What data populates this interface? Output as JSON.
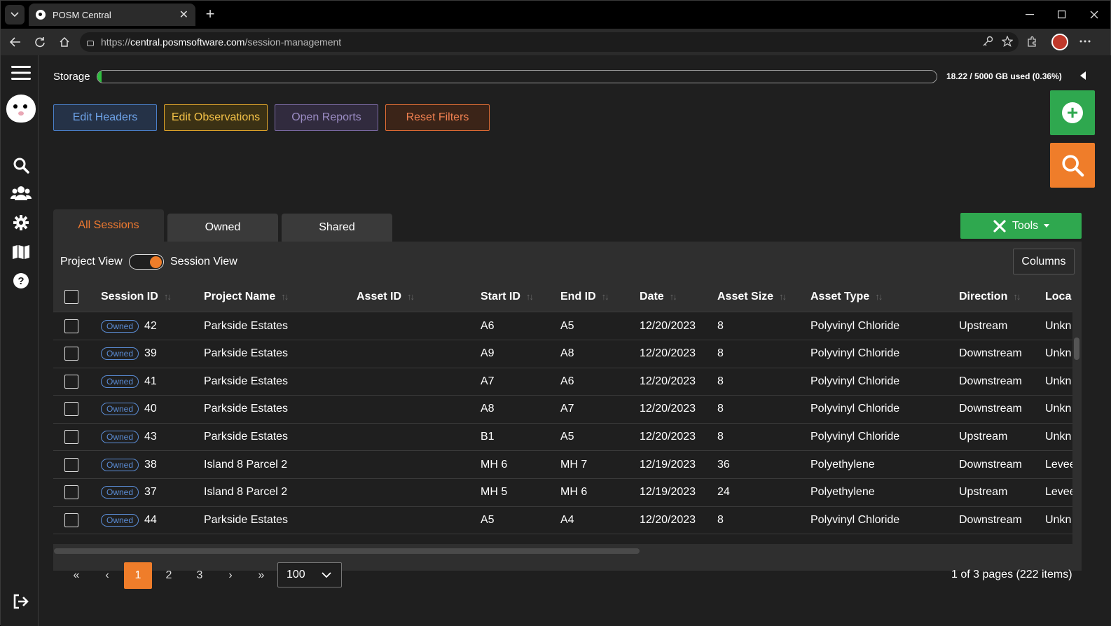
{
  "browser": {
    "tab_title": "POSM Central",
    "tab_close": "✕",
    "new_tab": "+",
    "url_scheme": "https://",
    "url_host": "central.posmsoftware.com",
    "url_path": "/session-management"
  },
  "storage": {
    "label": "Storage",
    "usage_text": "18.22 / 5000 GB used (0.36%)",
    "used_fraction": 0.0036
  },
  "actions": {
    "edit_headers": "Edit Headers",
    "edit_observations": "Edit Observations",
    "open_reports": "Open Reports",
    "reset_filters": "Reset Filters"
  },
  "session_tabs": [
    "All Sessions",
    "Owned",
    "Shared"
  ],
  "tools_label": "Tools",
  "view_toggle": {
    "left": "Project View",
    "right": "Session View"
  },
  "columns_button": "Columns",
  "table": {
    "headers": [
      "Session ID",
      "Project Name",
      "Asset ID",
      "Start ID",
      "End ID",
      "Date",
      "Asset Size",
      "Asset Type",
      "Direction",
      "Loca"
    ],
    "badge": "Owned",
    "rows": [
      [
        "42",
        "Parkside Estates",
        "",
        "A6",
        "A5",
        "12/20/2023",
        "8",
        "Polyvinyl Chloride",
        "Upstream",
        "Unkn"
      ],
      [
        "39",
        "Parkside Estates",
        "",
        "A9",
        "A8",
        "12/20/2023",
        "8",
        "Polyvinyl Chloride",
        "Downstream",
        "Unkn"
      ],
      [
        "41",
        "Parkside Estates",
        "",
        "A7",
        "A6",
        "12/20/2023",
        "8",
        "Polyvinyl Chloride",
        "Downstream",
        "Unkn"
      ],
      [
        "40",
        "Parkside Estates",
        "",
        "A8",
        "A7",
        "12/20/2023",
        "8",
        "Polyvinyl Chloride",
        "Downstream",
        "Unkn"
      ],
      [
        "43",
        "Parkside Estates",
        "",
        "B1",
        "A5",
        "12/20/2023",
        "8",
        "Polyvinyl Chloride",
        "Upstream",
        "Unkn"
      ],
      [
        "38",
        "Island 8 Parcel 2",
        "",
        "MH 6",
        "MH 7",
        "12/19/2023",
        "36",
        "Polyethylene",
        "Downstream",
        "Levee"
      ],
      [
        "37",
        "Island 8 Parcel 2",
        "",
        "MH 5",
        "MH 6",
        "12/19/2023",
        "24",
        "Polyethylene",
        "Upstream",
        "Levee"
      ],
      [
        "44",
        "Parkside Estates",
        "",
        "A5",
        "A4",
        "12/20/2023",
        "8",
        "Polyvinyl Chloride",
        "Downstream",
        "Unkn"
      ]
    ]
  },
  "pager": {
    "first": "«",
    "prev": "‹",
    "pages": [
      "1",
      "2",
      "3"
    ],
    "next": "›",
    "last": "»",
    "page_size": "100",
    "info": "1 of 3 pages (222 items)"
  }
}
